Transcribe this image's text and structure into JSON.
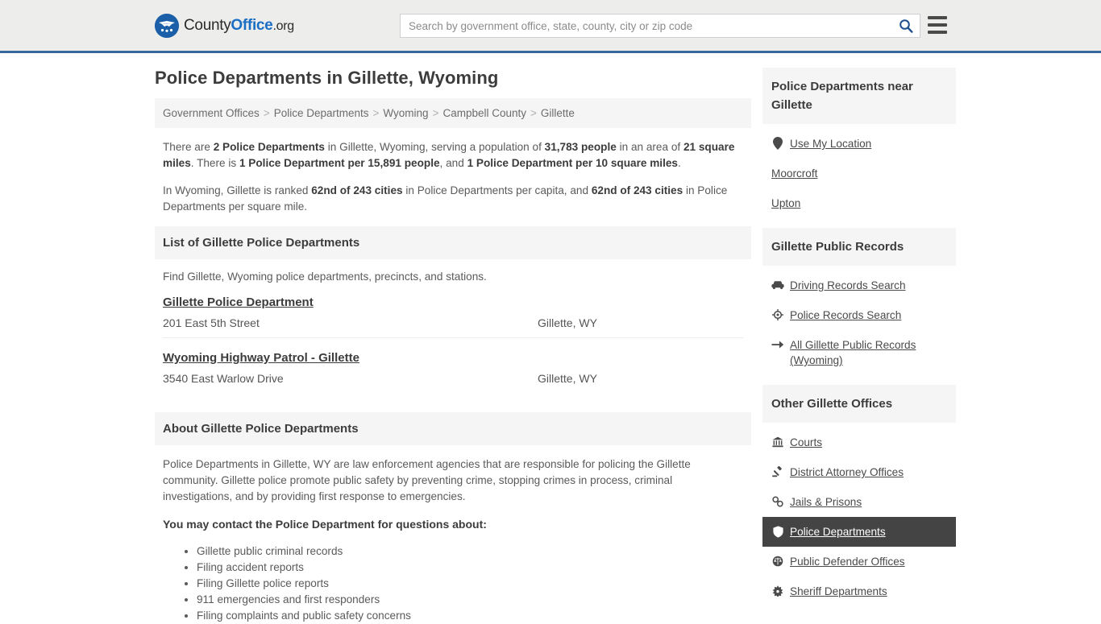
{
  "header": {
    "logo": {
      "part1": "County",
      "part2": "Office",
      "part3": ".org",
      "icon": "eagle-shield-logo"
    },
    "search": {
      "placeholder": "Search by government office, state, county, city or zip code",
      "value": "",
      "icon": "search-icon"
    },
    "menu_icon": "hamburger-menu-icon",
    "accent_color": "#36689e",
    "background_color": "#ededeb"
  },
  "page": {
    "title": "Police Departments in Gillette, Wyoming"
  },
  "breadcrumb": {
    "items": [
      {
        "label": "Government Offices"
      },
      {
        "label": "Police Departments"
      },
      {
        "label": "Wyoming"
      },
      {
        "label": "Campbell County"
      },
      {
        "label": "Gillette"
      }
    ],
    "separator": ">"
  },
  "stats": {
    "paragraph1": {
      "segments": [
        {
          "text": "There are ",
          "bold": false
        },
        {
          "text": "2 Police Departments",
          "bold": true
        },
        {
          "text": " in Gillette, Wyoming, serving a population of ",
          "bold": false
        },
        {
          "text": "31,783 people",
          "bold": true
        },
        {
          "text": " in an area of ",
          "bold": false
        },
        {
          "text": "21 square miles",
          "bold": true
        },
        {
          "text": ". There is ",
          "bold": false
        },
        {
          "text": "1 Police Department per 15,891 people",
          "bold": true
        },
        {
          "text": ", and ",
          "bold": false
        },
        {
          "text": "1 Police Department per 10 square miles",
          "bold": true
        },
        {
          "text": ".",
          "bold": false
        }
      ]
    },
    "paragraph2": {
      "segments": [
        {
          "text": "In Wyoming, Gillette is ranked ",
          "bold": false
        },
        {
          "text": "62nd of 243 cities",
          "bold": true
        },
        {
          "text": " in Police Departments per capita, and ",
          "bold": false
        },
        {
          "text": "62nd of 243 cities",
          "bold": true
        },
        {
          "text": " in Police Departments per square mile.",
          "bold": false
        }
      ]
    }
  },
  "list_section": {
    "heading": "List of Gillette Police Departments",
    "subtitle": "Find Gillette, Wyoming police departments, precincts, and stations.",
    "items": [
      {
        "name": "Gillette Police Department",
        "address": "201 East 5th Street",
        "city": "Gillette, WY"
      },
      {
        "name": "Wyoming Highway Patrol - Gillette",
        "address": "3540 East Warlow Drive",
        "city": "Gillette, WY"
      }
    ]
  },
  "about_section": {
    "heading": "About Gillette Police Departments",
    "paragraph": "Police Departments in Gillette, WY are law enforcement agencies that are responsible for policing the Gillette community. Gillette police promote public safety by preventing crime, stopping crimes in process, criminal investigations, and by providing first response to emergencies.",
    "contact_heading": "You may contact the Police Department for questions about:",
    "bullets": [
      "Gillette public criminal records",
      "Filing accident reports",
      "Filing Gillette police reports",
      "911 emergencies and first responders",
      "Filing complaints and public safety concerns"
    ]
  },
  "sidebar": {
    "near_panel": {
      "heading": "Police Departments near Gillette",
      "links": [
        {
          "label": "Use My Location",
          "icon": "map-pin-icon"
        },
        {
          "label": "Moorcroft",
          "icon": ""
        },
        {
          "label": "Upton",
          "icon": ""
        }
      ]
    },
    "records_panel": {
      "heading": "Gillette Public Records",
      "links": [
        {
          "label": "Driving Records Search",
          "icon": "car-icon"
        },
        {
          "label": "Police Records Search",
          "icon": "police-badge-icon"
        },
        {
          "label": "All Gillette Public Records (Wyoming)",
          "icon": "arrow-right-icon"
        }
      ]
    },
    "offices_panel": {
      "heading": "Other Gillette Offices",
      "links": [
        {
          "label": "Courts",
          "icon": "courthouse-icon",
          "active": false
        },
        {
          "label": "District Attorney Offices",
          "icon": "gavel-icon",
          "active": false
        },
        {
          "label": "Jails & Prisons",
          "icon": "handcuffs-icon",
          "active": false
        },
        {
          "label": "Police Departments",
          "icon": "shield-icon",
          "active": true
        },
        {
          "label": "Public Defender Offices",
          "icon": "scales-icon",
          "active": false
        },
        {
          "label": "Sheriff Departments",
          "icon": "sheriff-star-icon",
          "active": false
        }
      ]
    },
    "active_background": "#444444"
  }
}
